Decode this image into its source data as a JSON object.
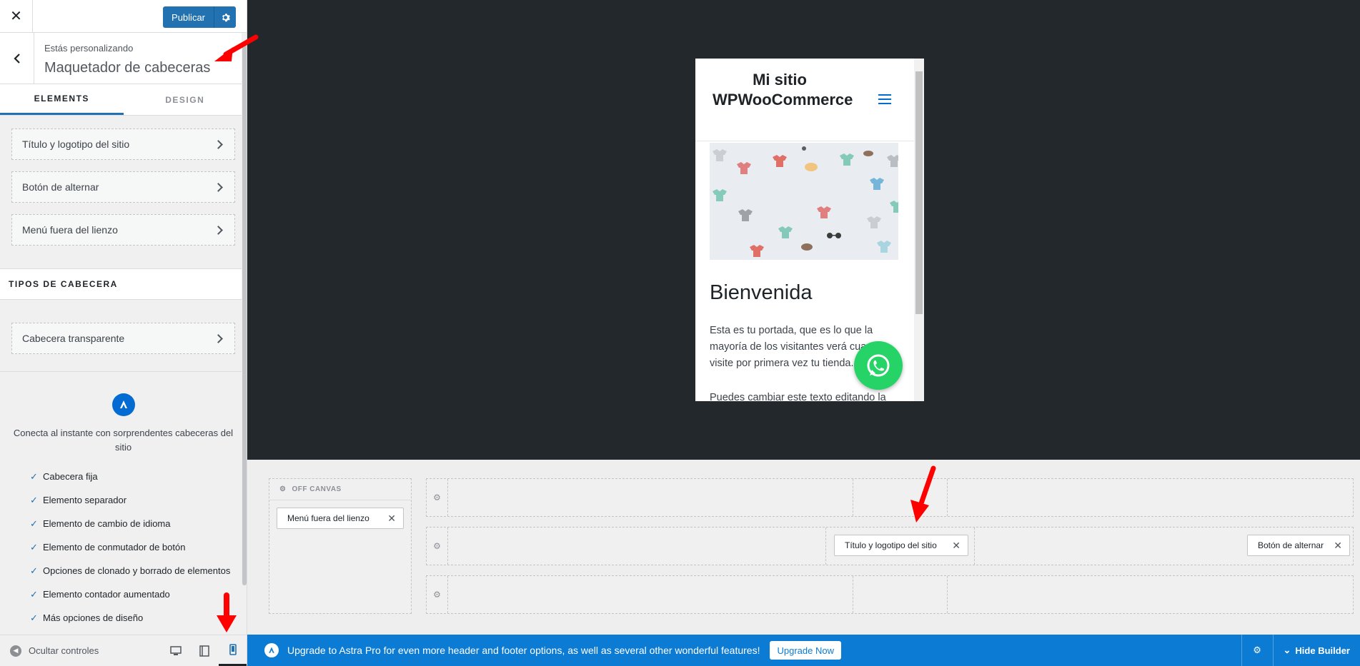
{
  "topbar": {
    "publish_label": "Publicar"
  },
  "section": {
    "subtitle": "Estás personalizando",
    "title": "Maquetador de cabeceras"
  },
  "tabs": [
    {
      "label": "ELEMENTS"
    },
    {
      "label": "DESIGN"
    }
  ],
  "elements": [
    {
      "label": "Título y logotipo del sitio"
    },
    {
      "label": "Botón de alternar"
    },
    {
      "label": "Menú fuera del lienzo"
    }
  ],
  "header_types": {
    "title": "TIPOS DE CABECERA",
    "items": [
      {
        "label": "Cabecera transparente"
      }
    ]
  },
  "promo": {
    "text": "Conecta al instante con sorprendentes cabeceras del sitio",
    "features": [
      "Cabecera fija",
      "Elemento separador",
      "Elemento de cambio de idioma",
      "Elemento de conmutador de botón",
      "Opciones de clonado y borrado de elementos",
      "Elemento contador aumentado",
      "Más opciones de diseño"
    ]
  },
  "footer": {
    "hide_controls": "Ocultar controles"
  },
  "preview": {
    "site_title": "Mi sitio WPWooCommerce",
    "heading": "Bienvenida",
    "para1": "Esta es tu portada, que es lo que la mayoría de los visitantes verá cuando visite por primera vez tu tienda.",
    "para2": "Puedes cambiar este texto editando la"
  },
  "builder": {
    "off_canvas_label": "OFF CANVAS",
    "off_canvas_chip": "Menú fuera del lienzo",
    "center_chip": "Título y logotipo del sitio",
    "right_chip": "Botón de alternar"
  },
  "bottom_bar": {
    "text": "Upgrade to Astra Pro for even more header and footer options, as well as several other wonderful features!",
    "upgrade_label": "Upgrade Now",
    "hide_builder": "Hide Builder"
  },
  "colors": {
    "accent": "#2271b1",
    "astra_blue": "#0b7bd4",
    "whatsapp": "#25d366",
    "arrow": "#ff0000"
  }
}
